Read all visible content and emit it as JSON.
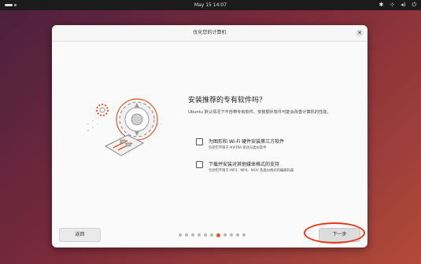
{
  "topbar": {
    "clock": "May 15  14:07",
    "tray_icons": [
      "accessibility-icon",
      "network-icon",
      "volume-icon",
      "power-icon"
    ]
  },
  "dialog": {
    "title": "优化您的计算机",
    "heading": "安装推荐的专有软件吗？",
    "description": "Ubuntu 默认情况下不自带专有软件。安装额外软件可能会改善计算机的性能。",
    "options": [
      {
        "label": "为图形和 Wi-Fi 硬件安装第三方软件",
        "sub": "包括但不限于 NVIDIA 驱动与类似软件",
        "checked": false
      },
      {
        "label": "下载并安装对其他媒体格式的支持",
        "sub": "包括但不限于 MP3、MP4、MOV 及类似格式的编解码器",
        "checked": false
      }
    ],
    "back_label": "返回",
    "next_label": "下一步",
    "progress": {
      "total": 11,
      "current": 7
    }
  },
  "colors": {
    "accent": "#e95420",
    "highlight_ring": "#e23a18"
  }
}
